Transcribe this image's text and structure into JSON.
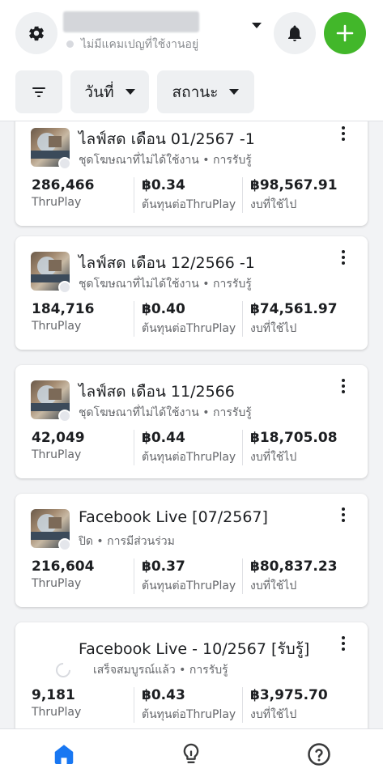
{
  "header": {
    "account_status": "ไม่มีแคมเปญที่ใช้งานอยู่",
    "filters": {
      "date_label": "วันที่",
      "status_label": "สถานะ"
    }
  },
  "metric_labels": {
    "results": "ThruPlay",
    "cost": "ต้นทุนต่อThruPlay",
    "spend": "งบที่ใช้ไป"
  },
  "campaigns": [
    {
      "title": "ไลฟ์สด เดือน 01/2567 -1",
      "subtitle": "ชุดโฆษณาที่ไม่ได้ใช้งาน • การรับรู้",
      "results": "286,466",
      "cost": "฿0.34",
      "spend": "฿98,567.91"
    },
    {
      "title": "ไลฟ์สด เดือน 12/2566 -1",
      "subtitle": "ชุดโฆษณาที่ไม่ได้ใช้งาน • การรับรู้",
      "results": "184,716",
      "cost": "฿0.40",
      "spend": "฿74,561.97"
    },
    {
      "title": "ไลฟ์สด เดือน 11/2566",
      "subtitle": "ชุดโฆษณาที่ไม่ได้ใช้งาน • การรับรู้",
      "results": "42,049",
      "cost": "฿0.44",
      "spend": "฿18,705.08"
    },
    {
      "title": "Facebook Live [07/2567]",
      "subtitle": "ปิด • การมีส่วนร่วม",
      "results": "216,604",
      "cost": "฿0.37",
      "spend": "฿80,837.23"
    },
    {
      "title": "Facebook Live - 10/2567 [รับรู้]",
      "subtitle": "เสร็จสมบูรณ์แล้ว • การรับรู้",
      "results": "9,181",
      "cost": "฿0.43",
      "spend": "฿3,975.70"
    }
  ],
  "colors": {
    "accent_green": "#42b72a",
    "nav_active_blue": "#1877f2"
  },
  "icons": {
    "header": [
      "gear-icon",
      "bell-icon",
      "plus-icon",
      "filter-icon"
    ],
    "nav": [
      "home-icon",
      "lightbulb-icon",
      "help-icon"
    ]
  }
}
